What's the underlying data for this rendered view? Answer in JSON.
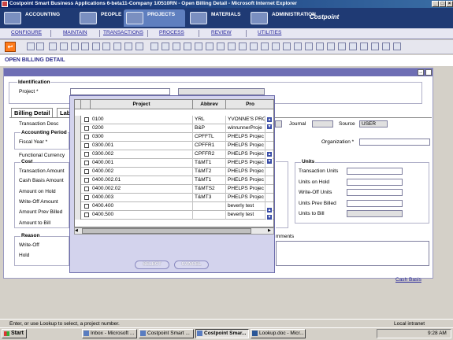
{
  "window": {
    "title": "Costpoint Smart Business Applications 6-beta11-Company 1/0510RN - Open Billing Detail - Microsoft Internet Explorer"
  },
  "nav": {
    "tabs": [
      {
        "label": "ACCOUNTING"
      },
      {
        "label": "PEOPLE"
      },
      {
        "label": "PROJECTS"
      },
      {
        "label": "MATERIALS"
      },
      {
        "label": "ADMINISTRATION"
      }
    ],
    "logo": "Costpoint"
  },
  "submenu": [
    "CONFIGURE",
    "MAINTAIN",
    "TRANSACTIONS",
    "PROCESS",
    "REVIEW",
    "UTILITIES"
  ],
  "page": {
    "title": "OPEN BILLING DETAIL"
  },
  "identification": {
    "heading": "Identification",
    "project_label": "Project *"
  },
  "tabs": [
    "Billing Detail",
    "Lab"
  ],
  "form": {
    "transaction_desc": "Transaction Desc",
    "accounting_period": "Accounting Period",
    "fiscal_year": "Fiscal Year *",
    "journal": "Journal",
    "source": "Source",
    "source_value": "USER",
    "organization": "Organization *",
    "functional_currency": "Functional Currency",
    "cost": "Cost",
    "cost_items": [
      "Transaction Amount",
      "Cash Basis Amount",
      "Amount on Hold",
      "Write-Off Amount",
      "Amount Prev Billed",
      "Amount to Bill"
    ],
    "units": "Units",
    "unit_items": [
      "Transaction Units",
      "Units on Hold",
      "Write-Off Units",
      "Units Prev Billed",
      "Units to Bill"
    ],
    "reason": "Reason",
    "reason_items": [
      "Write-Off",
      "Hold"
    ],
    "comments": "mments",
    "cash_basis_link": "Cash Basis"
  },
  "lookup": {
    "columns": [
      "Project",
      "Abbrev",
      "Pro"
    ],
    "rows": [
      {
        "project": "0100",
        "abbrev": "YRL",
        "name": "YVONNE'S PROJ"
      },
      {
        "project": "0200",
        "abbrev": "B&P",
        "name": "winrunnerProje"
      },
      {
        "project": "0300",
        "abbrev": "CPFFTL",
        "name": "PHELPS Projec"
      },
      {
        "project": "0300.001",
        "abbrev": "CPFFR1",
        "name": "PHELPS Projec"
      },
      {
        "project": "0300.002",
        "abbrev": "CPFFR2",
        "name": "PHELPS Projec"
      },
      {
        "project": "0400.001",
        "abbrev": "T&MT1",
        "name": "PHELPS Projec"
      },
      {
        "project": "0400.002",
        "abbrev": "T&MT2",
        "name": "PHELPS Projec"
      },
      {
        "project": "0400.002.01",
        "abbrev": "T&MT1",
        "name": "PHELPS Projec"
      },
      {
        "project": "0400.002.02",
        "abbrev": "T&MTS2",
        "name": "PHELPS Projec"
      },
      {
        "project": "0400.003",
        "abbrev": "T&MT3",
        "name": "PHELPS Projec"
      },
      {
        "project": "0400.400",
        "abbrev": "",
        "name": "beverly test"
      },
      {
        "project": "0400.500",
        "abbrev": "",
        "name": "beverly test"
      }
    ],
    "select_label": "SELECT",
    "cancel_label": "CANCEL"
  },
  "status": {
    "text": "Enter, or use Lookup to select, a project number.",
    "zone": "Local intranet"
  },
  "taskbar": {
    "start": "Start",
    "items": [
      "Inbox - Microsoft ...",
      "Costpoint Smart ...",
      "Costpoint Smar...",
      "Lookup.doc - Micr..."
    ],
    "clock": "9:28 AM"
  }
}
